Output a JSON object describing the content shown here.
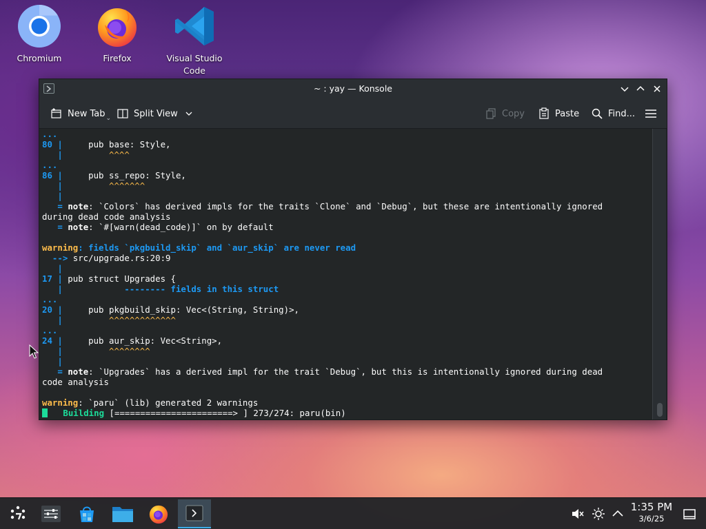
{
  "desktop": {
    "icons": [
      {
        "label": "Chromium",
        "icon": "chromium-icon"
      },
      {
        "label": "Firefox",
        "icon": "firefox-icon"
      },
      {
        "label": "Visual Studio\nCode",
        "icon": "vscode-icon"
      }
    ]
  },
  "window": {
    "title": "~ : yay — Konsole",
    "toolbar": {
      "new_tab": "New Tab",
      "split_view": "Split View",
      "copy": "Copy",
      "paste": "Paste",
      "find": "Find..."
    }
  },
  "terminal": {
    "lines": [
      [
        [
          "...",
          "blue"
        ]
      ],
      [
        [
          "80 |",
          "blue"
        ],
        [
          "     pub base: Style,",
          ""
        ]
      ],
      [
        [
          "   |",
          "blue"
        ],
        [
          "         ",
          ""
        ],
        [
          "^^^^",
          "yellown"
        ]
      ],
      [
        [
          "...",
          "blue"
        ]
      ],
      [
        [
          "86 |",
          "blue"
        ],
        [
          "     pub ss_repo: Style,",
          ""
        ]
      ],
      [
        [
          "   |",
          "blue"
        ],
        [
          "         ",
          ""
        ],
        [
          "^^^^^^^",
          "yellown"
        ]
      ],
      [
        [
          "   |",
          "blue"
        ]
      ],
      [
        [
          "   = ",
          "blue"
        ],
        [
          "note",
          "bold"
        ],
        [
          ": `Colors` has derived impls for the traits `Clone` and `Debug`, but these are intentionally ignored",
          ""
        ]
      ],
      [
        [
          "during dead code analysis",
          ""
        ]
      ],
      [
        [
          "   = ",
          "blue"
        ],
        [
          "note",
          "bold"
        ],
        [
          ": `#[warn(dead_code)]` on by default",
          ""
        ]
      ],
      [
        [
          "",
          ""
        ]
      ],
      [
        [
          "warning",
          "yellow"
        ],
        [
          ": fields `pkgbuild_skip` and `aur_skip` are never read",
          "blue"
        ]
      ],
      [
        [
          "  --> ",
          "blue"
        ],
        [
          "src/upgrade.rs:20:9",
          ""
        ]
      ],
      [
        [
          "   |",
          "blue"
        ]
      ],
      [
        [
          "17 |",
          "blue"
        ],
        [
          " pub struct Upgrades {",
          ""
        ]
      ],
      [
        [
          "   |",
          "blue"
        ],
        [
          "            ",
          ""
        ],
        [
          "-------- fields in this struct",
          "blue"
        ]
      ],
      [
        [
          "...",
          "blue"
        ]
      ],
      [
        [
          "20 |",
          "blue"
        ],
        [
          "     pub pkgbuild_skip: Vec<(String, String)>,",
          ""
        ]
      ],
      [
        [
          "   |",
          "blue"
        ],
        [
          "         ",
          ""
        ],
        [
          "^^^^^^^^^^^^^",
          "yellown"
        ]
      ],
      [
        [
          "...",
          "blue"
        ]
      ],
      [
        [
          "24 |",
          "blue"
        ],
        [
          "     pub aur_skip: Vec<String>,",
          ""
        ]
      ],
      [
        [
          "   |",
          "blue"
        ],
        [
          "         ",
          ""
        ],
        [
          "^^^^^^^^",
          "yellown"
        ]
      ],
      [
        [
          "   |",
          "blue"
        ]
      ],
      [
        [
          "   = ",
          "blue"
        ],
        [
          "note",
          "bold"
        ],
        [
          ": `Upgrades` has a derived impl for the trait `Debug`, but this is intentionally ignored during dead",
          ""
        ]
      ],
      [
        [
          "code analysis",
          ""
        ]
      ],
      [
        [
          "",
          ""
        ]
      ],
      [
        [
          "warning",
          "yellow"
        ],
        [
          ": `paru` (lib) generated 2 warnings",
          ""
        ]
      ],
      [
        [
          "CURSOR",
          "cursor"
        ],
        [
          "   Building",
          "green"
        ],
        [
          " [=======================> ] 273/274: paru(bin)",
          ""
        ]
      ]
    ]
  },
  "taskbar": {
    "items": [
      {
        "name": "application-launcher",
        "icon": "kde-launcher-icon"
      },
      {
        "name": "system-settings",
        "icon": "settings-sliders-icon"
      },
      {
        "name": "discover",
        "icon": "store-bag-icon"
      },
      {
        "name": "dolphin",
        "icon": "folder-icon"
      },
      {
        "name": "firefox",
        "icon": "firefox-icon"
      },
      {
        "name": "konsole",
        "icon": "terminal-icon",
        "active": true
      }
    ],
    "clock": {
      "time": "1:35 PM",
      "date": "3/6/25"
    },
    "tray": [
      "volume-muted-icon",
      "brightness-icon",
      "tray-expand-icon",
      "show-desktop-icon"
    ]
  }
}
